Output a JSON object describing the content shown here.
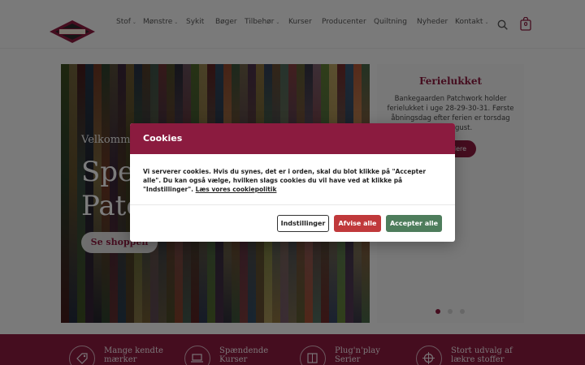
{
  "brand": {
    "logo_text": "Bankegaarden",
    "accent": "#8b1b3f"
  },
  "nav": {
    "items": [
      {
        "label": "Stof",
        "dropdown": true
      },
      {
        "label": "Mønstre",
        "dropdown": true
      },
      {
        "label": "Sykit",
        "dropdown": false
      },
      {
        "label": "Bøger",
        "dropdown": false
      },
      {
        "label": "Tilbehør",
        "dropdown": true
      },
      {
        "label": "Kurser",
        "dropdown": false
      },
      {
        "label": "Producenter",
        "dropdown": false
      },
      {
        "label": "Quiltning",
        "dropdown": false
      },
      {
        "label": "Nyheder",
        "dropdown": false
      },
      {
        "label": "Kontakt",
        "dropdown": true
      }
    ],
    "search_icon": "search-icon",
    "cart_count": "0"
  },
  "hero": {
    "subtitle": "Velkommen",
    "title_line1": "Spe",
    "title_line2": "Patc",
    "button": "Se shoppen"
  },
  "closure": {
    "title": "Ferielukket",
    "text": "Bankegaarden Patchwork holder ferielukket i uge 28-29-30-31. Første åbningsdag efter ferien er torsdag d. 4. august.",
    "button": "dere"
  },
  "slider": {
    "active_index": 0,
    "count": 3
  },
  "features": [
    {
      "label": "Mange kendte mærker",
      "icon": "tag-icon"
    },
    {
      "label": "Spændende Kurser",
      "icon": "laptop-icon"
    },
    {
      "label": "Plug'n'play Serier",
      "icon": "fabric-icon"
    },
    {
      "label": "Stort udvalg af lækre stoffer",
      "icon": "spool-icon"
    }
  ],
  "cookie_dialog": {
    "title": "Cookies",
    "body": "Vi serverer cookies. Hvis du synes, det er i orden, skal du blot klikke på \"Accepter alle\". Du kan også vælge, hvilken slags cookies du vil have ved at klikke på \"Indstillinger\". ",
    "policy_link": "Læs vores cookiepolitik",
    "settings_label": "Indstillinger",
    "reject_label": "Afvise alle",
    "accept_label": "Accepter alle"
  }
}
